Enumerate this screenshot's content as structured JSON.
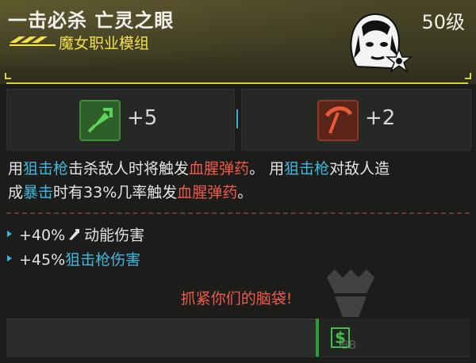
{
  "header": {
    "title": "一击必杀 亡灵之眼",
    "level": "50级",
    "subtitle": "魔女职业模组"
  },
  "stats": {
    "left": {
      "icon": "reflex-attribute-icon",
      "value": "+5"
    },
    "right": {
      "icon": "cool-attribute-icon",
      "value": "+2"
    }
  },
  "description": {
    "p1": "用",
    "p2": "狙击枪",
    "p3": "击杀敌人时将触发",
    "p4": "血腥弹药",
    "p5": "。 用",
    "p6": "狙击枪",
    "p7": "对敌人造",
    "p8": "成",
    "p9": "暴击",
    "p10": "时有33%几率触发",
    "p11": "血腥弹药",
    "p12": "。"
  },
  "bonuses": {
    "b1_value": "+40%",
    "b1_label": "动能伤害",
    "b2_value": "+45%",
    "b2_label": "狙击枪伤害"
  },
  "quote": "抓紧你们的脑袋!",
  "watermark": "BB",
  "colors": {
    "accent_yellow": "#f2e14a",
    "highlight_blue": "#3fb8e0",
    "highlight_red": "#f05a4a",
    "price_green": "#2e9a3a"
  }
}
